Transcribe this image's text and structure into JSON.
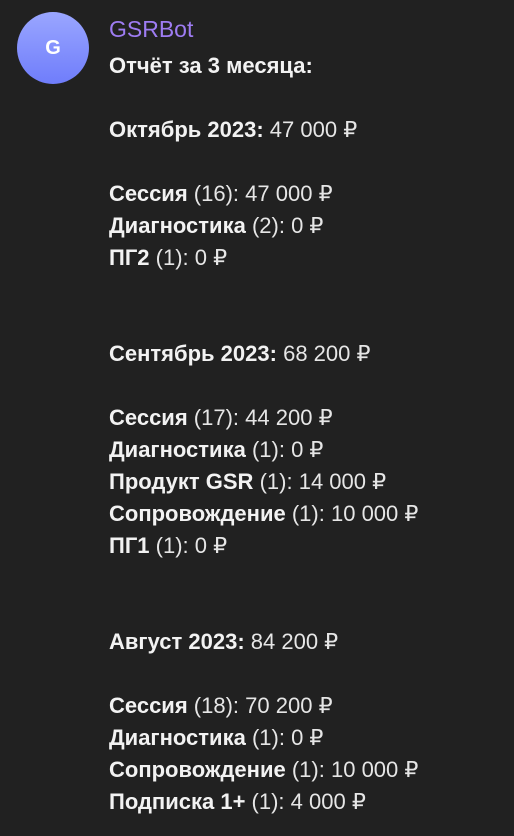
{
  "message": {
    "avatar_letter": "G",
    "sender": "GSRBot",
    "title": "Отчёт за 3 месяца:",
    "months": [
      {
        "name": "Октябрь 2023:",
        "total": "47 000 ₽",
        "items": [
          {
            "name": "Сессия",
            "count": "(16):",
            "amount": "47 000 ₽"
          },
          {
            "name": "Диагностика",
            "count": "(2):",
            "amount": "0 ₽"
          },
          {
            "name": "ПГ2",
            "count": "(1):",
            "amount": "0 ₽"
          }
        ]
      },
      {
        "name": "Сентябрь 2023:",
        "total": "68 200 ₽",
        "items": [
          {
            "name": "Сессия",
            "count": "(17):",
            "amount": "44 200 ₽"
          },
          {
            "name": "Диагностика",
            "count": "(1):",
            "amount": "0 ₽"
          },
          {
            "name": "Продукт GSR",
            "count": "(1):",
            "amount": "14 000 ₽"
          },
          {
            "name": "Сопровождение",
            "count": "(1):",
            "amount": "10 000 ₽"
          },
          {
            "name": "ПГ1",
            "count": "(1):",
            "amount": "0 ₽"
          }
        ]
      },
      {
        "name": "Август 2023:",
        "total": "84 200 ₽",
        "items": [
          {
            "name": "Сессия",
            "count": "(18):",
            "amount": "70 200 ₽"
          },
          {
            "name": "Диагностика",
            "count": "(1):",
            "amount": "0 ₽"
          },
          {
            "name": "Сопровождение",
            "count": "(1):",
            "amount": "10 000 ₽"
          },
          {
            "name": "Подписка 1+",
            "count": "(1):",
            "amount": "4 000 ₽"
          }
        ]
      }
    ]
  }
}
